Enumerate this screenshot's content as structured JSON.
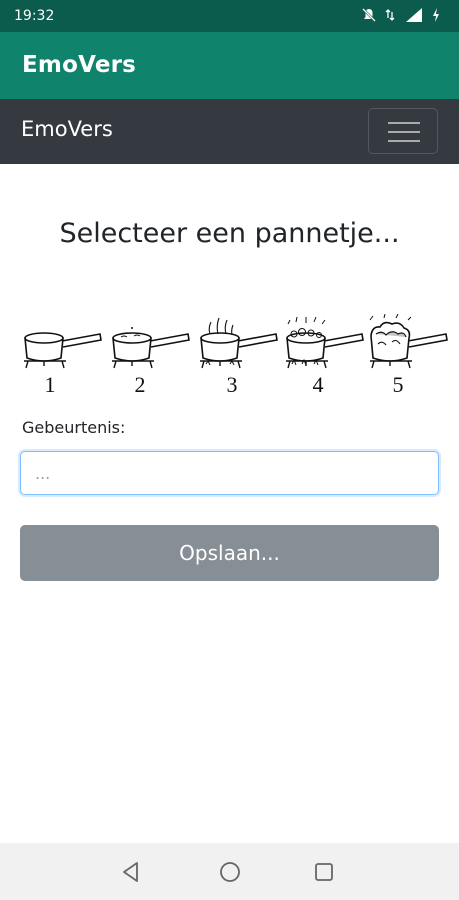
{
  "status_bar": {
    "time": "19:32",
    "icons": [
      "mute-icon",
      "data-icon",
      "signal-icon",
      "charging-icon"
    ]
  },
  "app_bar": {
    "title": "EmoVers"
  },
  "navbar": {
    "brand": "EmoVers",
    "toggler_icon": "hamburger-icon"
  },
  "main": {
    "heading": "Selecteer een pannetje...",
    "pots": [
      {
        "number": "1",
        "icon": "pot-calm-icon"
      },
      {
        "number": "2",
        "icon": "pot-warm-icon"
      },
      {
        "number": "3",
        "icon": "pot-steaming-icon"
      },
      {
        "number": "4",
        "icon": "pot-boiling-icon"
      },
      {
        "number": "5",
        "icon": "pot-overflowing-icon"
      }
    ],
    "event_label": "Gebeurtenis:",
    "event_placeholder": "...",
    "event_value": "",
    "save_label": "Opslaan..."
  },
  "system_nav": {
    "icons": [
      "back-icon",
      "home-icon",
      "recents-icon"
    ]
  },
  "colors": {
    "status_bar": "#0b5c4c",
    "app_bar": "#10836d",
    "navbar": "#343a40",
    "button": "#868e96",
    "input_focus": "#80bdff"
  }
}
